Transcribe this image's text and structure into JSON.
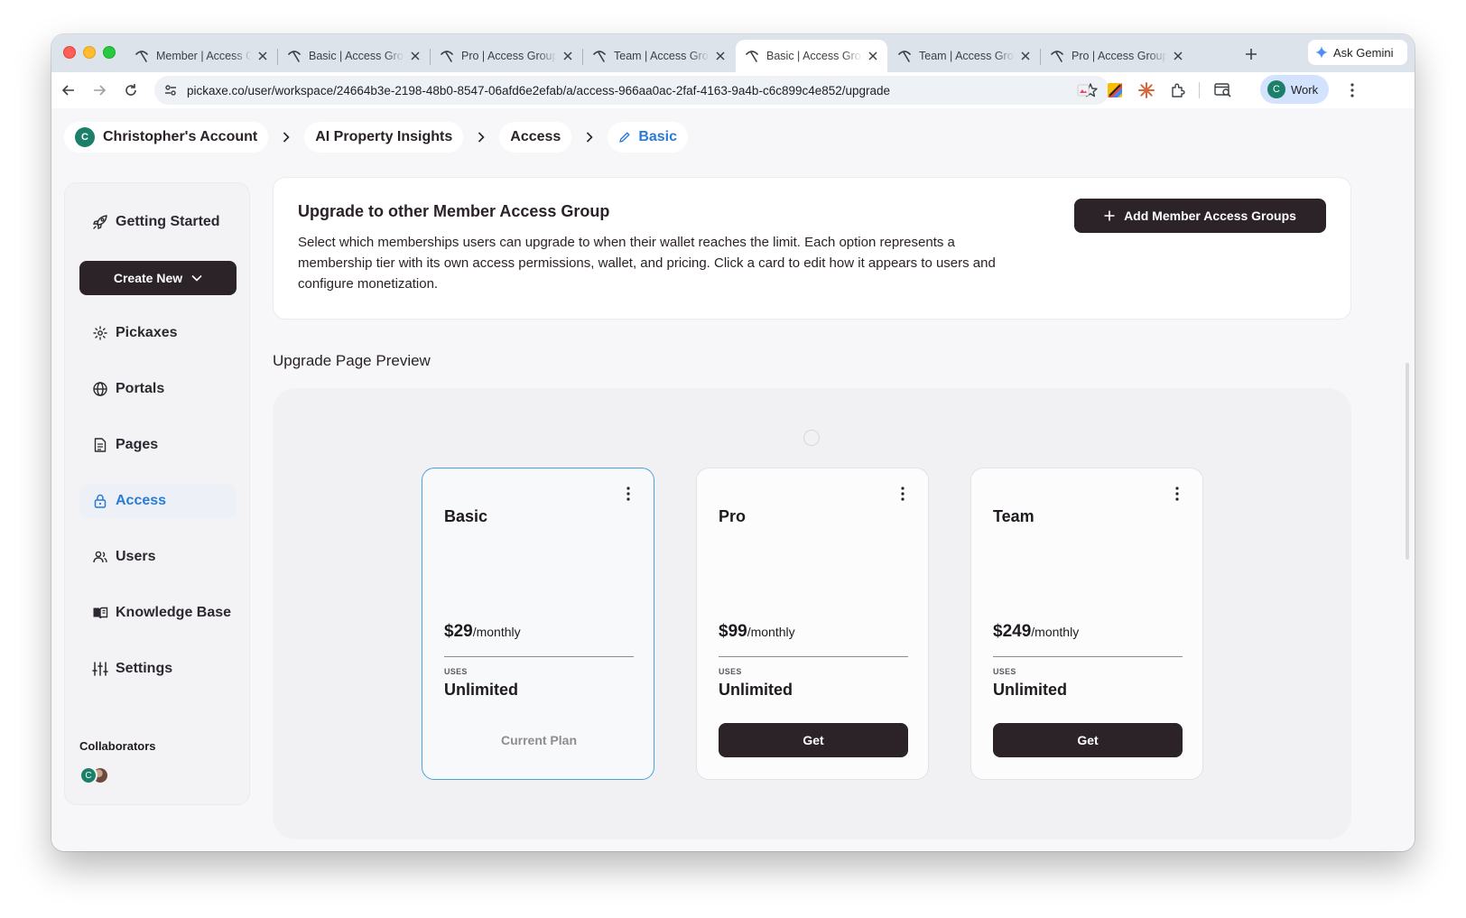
{
  "browser": {
    "tabs": [
      {
        "title": "Member | Access Groups",
        "active": false
      },
      {
        "title": "Basic | Access Group",
        "active": false
      },
      {
        "title": "Pro | Access Group",
        "active": false
      },
      {
        "title": "Team | Access Group",
        "active": false
      },
      {
        "title": "Basic | Access Group",
        "active": true
      },
      {
        "title": "Team | Access Group",
        "active": false
      },
      {
        "title": "Pro | Access Group",
        "active": false
      }
    ],
    "ask_gemini": "Ask Gemini",
    "url": "pickaxe.co/user/workspace/24664b3e-2198-48b0-8547-06afd6e2efab/a/access-966aa0ac-2faf-4163-9a4b-c6c899c4e852/upgrade",
    "profile_initial": "C",
    "profile_label": "Work"
  },
  "breadcrumb": {
    "account_initial": "C",
    "items": [
      "Christopher's Account",
      "AI Property Insights",
      "Access",
      "Basic"
    ]
  },
  "sidebar": {
    "getting_started": "Getting Started",
    "create_new": "Create New",
    "items": [
      {
        "label": "Pickaxes",
        "icon": "pickaxe-icon"
      },
      {
        "label": "Portals",
        "icon": "globe-icon"
      },
      {
        "label": "Pages",
        "icon": "page-icon"
      },
      {
        "label": "Access",
        "icon": "lock-icon",
        "active": true
      },
      {
        "label": "Users",
        "icon": "users-icon"
      },
      {
        "label": "Knowledge Base",
        "icon": "book-icon"
      },
      {
        "label": "Settings",
        "icon": "sliders-icon"
      }
    ],
    "collaborators_label": "Collaborators",
    "collaborator_initial": "C"
  },
  "upgrade": {
    "title": "Upgrade to other Member Access Group",
    "description": "Select which memberships users can upgrade to when their wallet reaches the limit. Each option represents a membership tier with its own access permissions, wallet, and pricing. Click a card to edit how it appears to users and configure monetization.",
    "add_button": "Add Member Access Groups"
  },
  "preview": {
    "label": "Upgrade Page Preview",
    "plans": [
      {
        "name": "Basic",
        "price": "$29",
        "period": "/monthly",
        "uses_label": "USES",
        "uses_value": "Unlimited",
        "action": "Current Plan",
        "current": true
      },
      {
        "name": "Pro",
        "price": "$99",
        "period": "/monthly",
        "uses_label": "USES",
        "uses_value": "Unlimited",
        "action": "Get",
        "current": false
      },
      {
        "name": "Team",
        "price": "$249",
        "period": "/monthly",
        "uses_label": "USES",
        "uses_value": "Unlimited",
        "action": "Get",
        "current": false
      }
    ]
  },
  "colors": {
    "accent": "#2a7bd5",
    "dark_button": "#2c2329",
    "current_plan_border": "#4ba1de"
  }
}
